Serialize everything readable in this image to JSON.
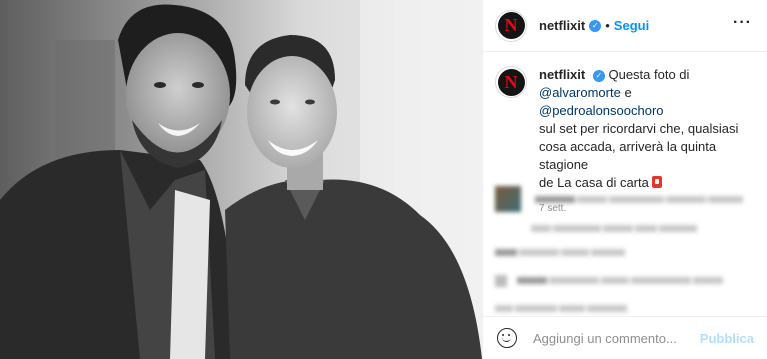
{
  "post": {
    "account": {
      "username": "netflixit",
      "avatar_letter": "N",
      "verified_glyph": "✓",
      "dot": "•",
      "follow_label": "Segui",
      "more_glyph": "···"
    },
    "caption": {
      "username": "netflixit",
      "text_lines": [
        "Questa foto di",
        "sul set per ricordarvi che, qualsiasi",
        "cosa accada, arriverà la quinta stagione",
        "de La casa di carta"
      ],
      "mention_1": "@alvaromorte",
      "joiner": " e ",
      "mention_2": "@pedroalonsoochoro"
    },
    "time_ago": "7 sett.",
    "comment_box": {
      "placeholder": "Aggiungi un commento...",
      "publish_label": "Pubblica"
    },
    "colors": {
      "brand_red": "#e50914",
      "link_blue": "#0095f6",
      "verified_blue": "#3897f0",
      "mention_blue": "#00376b",
      "muted_gray": "#8e8e8e",
      "publish_disabled": "#b2dffc"
    },
    "icons": [
      "verified-badge-icon",
      "more-options-icon",
      "emoji-icon",
      "red-flag-emoji-icon"
    ]
  }
}
